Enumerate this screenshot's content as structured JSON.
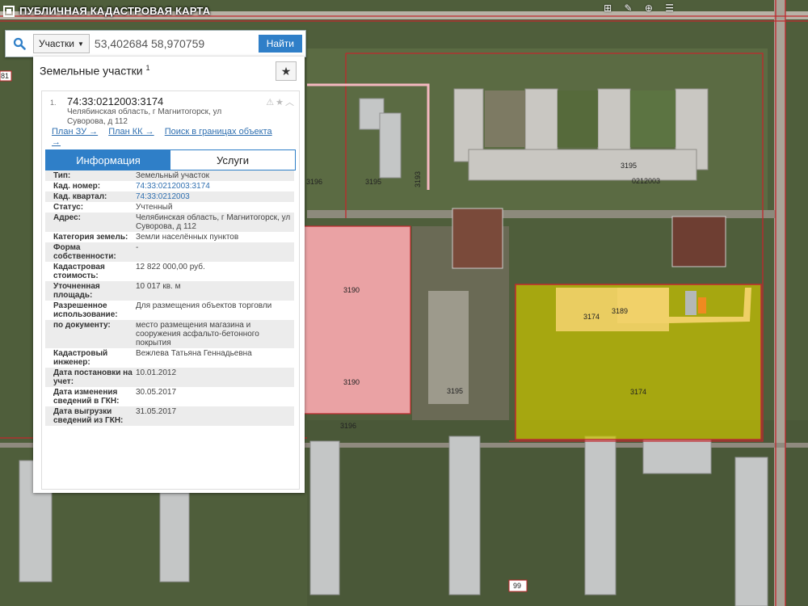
{
  "app": {
    "title": "ПУБЛИЧНАЯ КАДАСТРОВАЯ КАРТА",
    "top_icons": "⊞ ✎ ⊕ ☰"
  },
  "search": {
    "type_label": "Участки",
    "value": "53,402684 58,970759",
    "button_label": "Найти"
  },
  "panel": {
    "title": "Земельные участки",
    "title_sup": "1",
    "item_number": "1.",
    "item_title": "74:33:0212003:3174",
    "item_address": "Челябинская область, г Магнитогорск, ул Суворова, д 112",
    "links": [
      "План ЗУ →",
      "План КК →",
      "Поиск в границах объекта →"
    ],
    "tabs": [
      "Информация",
      "Услуги"
    ],
    "properties": [
      {
        "key": "Тип:",
        "value": "Земельный участок"
      },
      {
        "key": "Кад. номер:",
        "value": "74:33:0212003:3174",
        "link": true
      },
      {
        "key": "Кад. квартал:",
        "value": "74:33:0212003",
        "link": true
      },
      {
        "key": "Статус:",
        "value": "Учтенный"
      },
      {
        "key": "Адрес:",
        "value": "Челябинская область, г Магнитогорск, ул Суворова, д 112"
      },
      {
        "key": "Категория земель:",
        "value": "Земли населённых пунктов"
      },
      {
        "key": "Форма собственности:",
        "value": "-"
      },
      {
        "key": "Кадастровая стоимость:",
        "value": "12 822 000,00 руб."
      },
      {
        "key": "Уточненная площадь:",
        "value": "10 017 кв. м"
      },
      {
        "key": "Разрешенное использование:",
        "value": "Для размещения объектов торговли"
      },
      {
        "key": "по документу:",
        "value": "место размещения магазина и сооружения асфальто-бетонного покрытия"
      },
      {
        "key": "Кадастровый инженер:",
        "value": "Вежлева Татьяна Геннадьевна"
      },
      {
        "key": "Дата постановки на учет:",
        "value": "10.01.2012"
      },
      {
        "key": "Дата изменения сведений в ГКН:",
        "value": "30.05.2017"
      },
      {
        "key": "Дата выгрузки сведений из ГКН:",
        "value": "31.05.2017"
      }
    ]
  },
  "map_labels": {
    "parcel_3190_a": "3190",
    "parcel_3190_b": "3190",
    "parcel_3174_a": "3174",
    "parcel_3174_b": "3174",
    "parcel_3189": "3189",
    "parcel_3195_a": "3195",
    "parcel_3195_b": "3195",
    "parcel_3195_c": "3195",
    "parcel_3196_a": "3196",
    "parcel_3196_b": "3196",
    "parcel_3193": "3193",
    "quarter": "0212003",
    "badge_81": "81",
    "badge_99": "99"
  },
  "colors": {
    "accent": "#2f7fc8",
    "parcel_pink": "#f7a8ae",
    "parcel_yellow": "#c8c400",
    "parcel_light_yellow": "#f2d26a",
    "boundary_red": "#c0282d"
  }
}
